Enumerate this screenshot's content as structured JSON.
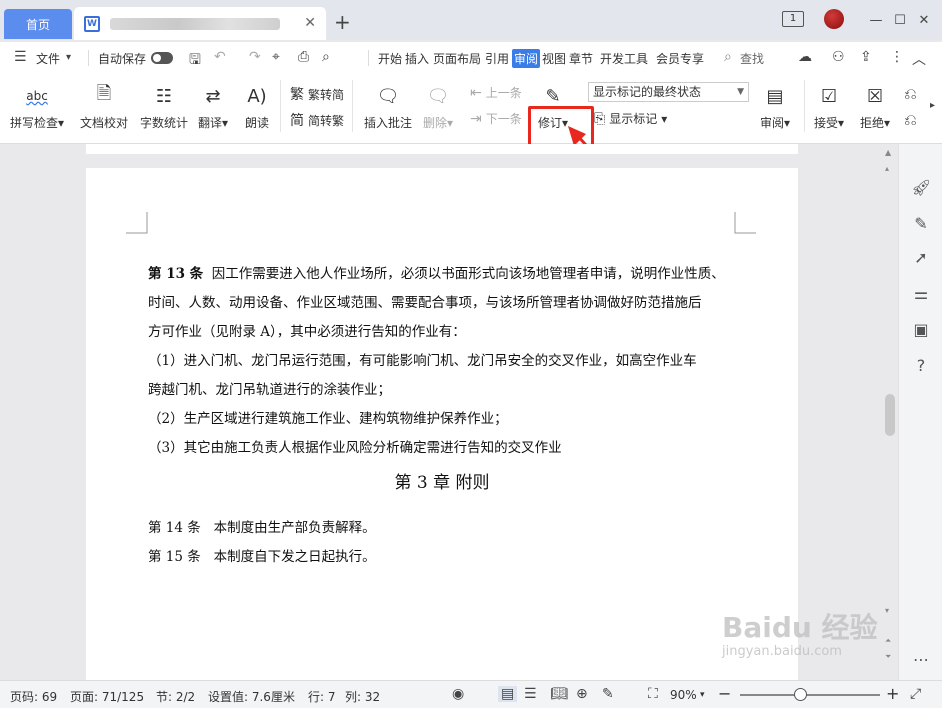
{
  "titlebar": {
    "home_tab": "首页",
    "doc_icon": "W",
    "tab_count": "1"
  },
  "menubar": {
    "file_label": "文件",
    "autosave_label": "自动保存",
    "menus": [
      "开始",
      "插入",
      "页面布局",
      "引用",
      "审阅",
      "视图",
      "章节",
      "开发工具",
      "会员专享"
    ],
    "active_menu": "审阅",
    "search_label": "查找"
  },
  "ribbon": {
    "spell_check": "拼写检查",
    "doc_proof": "文档校对",
    "word_count": "字数统计",
    "translate": "翻译",
    "read_aloud": "朗读",
    "trad_simp": "繁转简",
    "simp_trad": "简转繁",
    "insert_comment": "插入批注",
    "delete": "删除",
    "prev_item": "上一条",
    "next_item": "下一条",
    "track_changes": "修订",
    "markup_mode": "显示标记的最终状态",
    "show_markup": "显示标记",
    "review": "审阅",
    "accept": "接受",
    "reject": "拒绝",
    "spell_icon_text": "abc"
  },
  "document": {
    "art13_label": "第 13 条",
    "art13_text": "因工作需要进入他人作业场所，必须以书面形式向该场地管理者申请，说明作业性质、",
    "line2": "时间、人数、动用设备、作业区域范围、需要配合事项，与该场所管理者协调做好防范措施后",
    "line3": "方可作业（见附录 A），其中必须进行告知的作业有：",
    "line4": "（1）进入门机、龙门吊运行范围，有可能影响门机、龙门吊安全的交叉作业，如高空作业车",
    "line5": "跨越门机、龙门吊轨道进行的涂装作业；",
    "line6": "（2）生产区域进行建筑施工作业、建构筑物维护保养作业；",
    "line7": "（3）其它由施工负责人根据作业风险分析确定需进行告知的交叉作业",
    "chapter_title": "第 3 章  附则",
    "art14_label": "第 14 条",
    "art14_text": "本制度由生产部负责解释。",
    "art15_label": "第 15 条",
    "art15_text": "本制度自下发之日起执行。"
  },
  "statusbar": {
    "page_code": "页码: 69",
    "page_num": "页面: 71/125",
    "section": "节: 2/2",
    "set_value": "设置值: 7.6厘米",
    "row": "行: 7",
    "col": "列: 32",
    "zoom": "90%"
  },
  "watermark": {
    "brand": "Baidu 经验",
    "url": "jingyan.baidu.com"
  },
  "colors": {
    "accent": "#3a7ce8",
    "highlight": "#e8281f"
  }
}
